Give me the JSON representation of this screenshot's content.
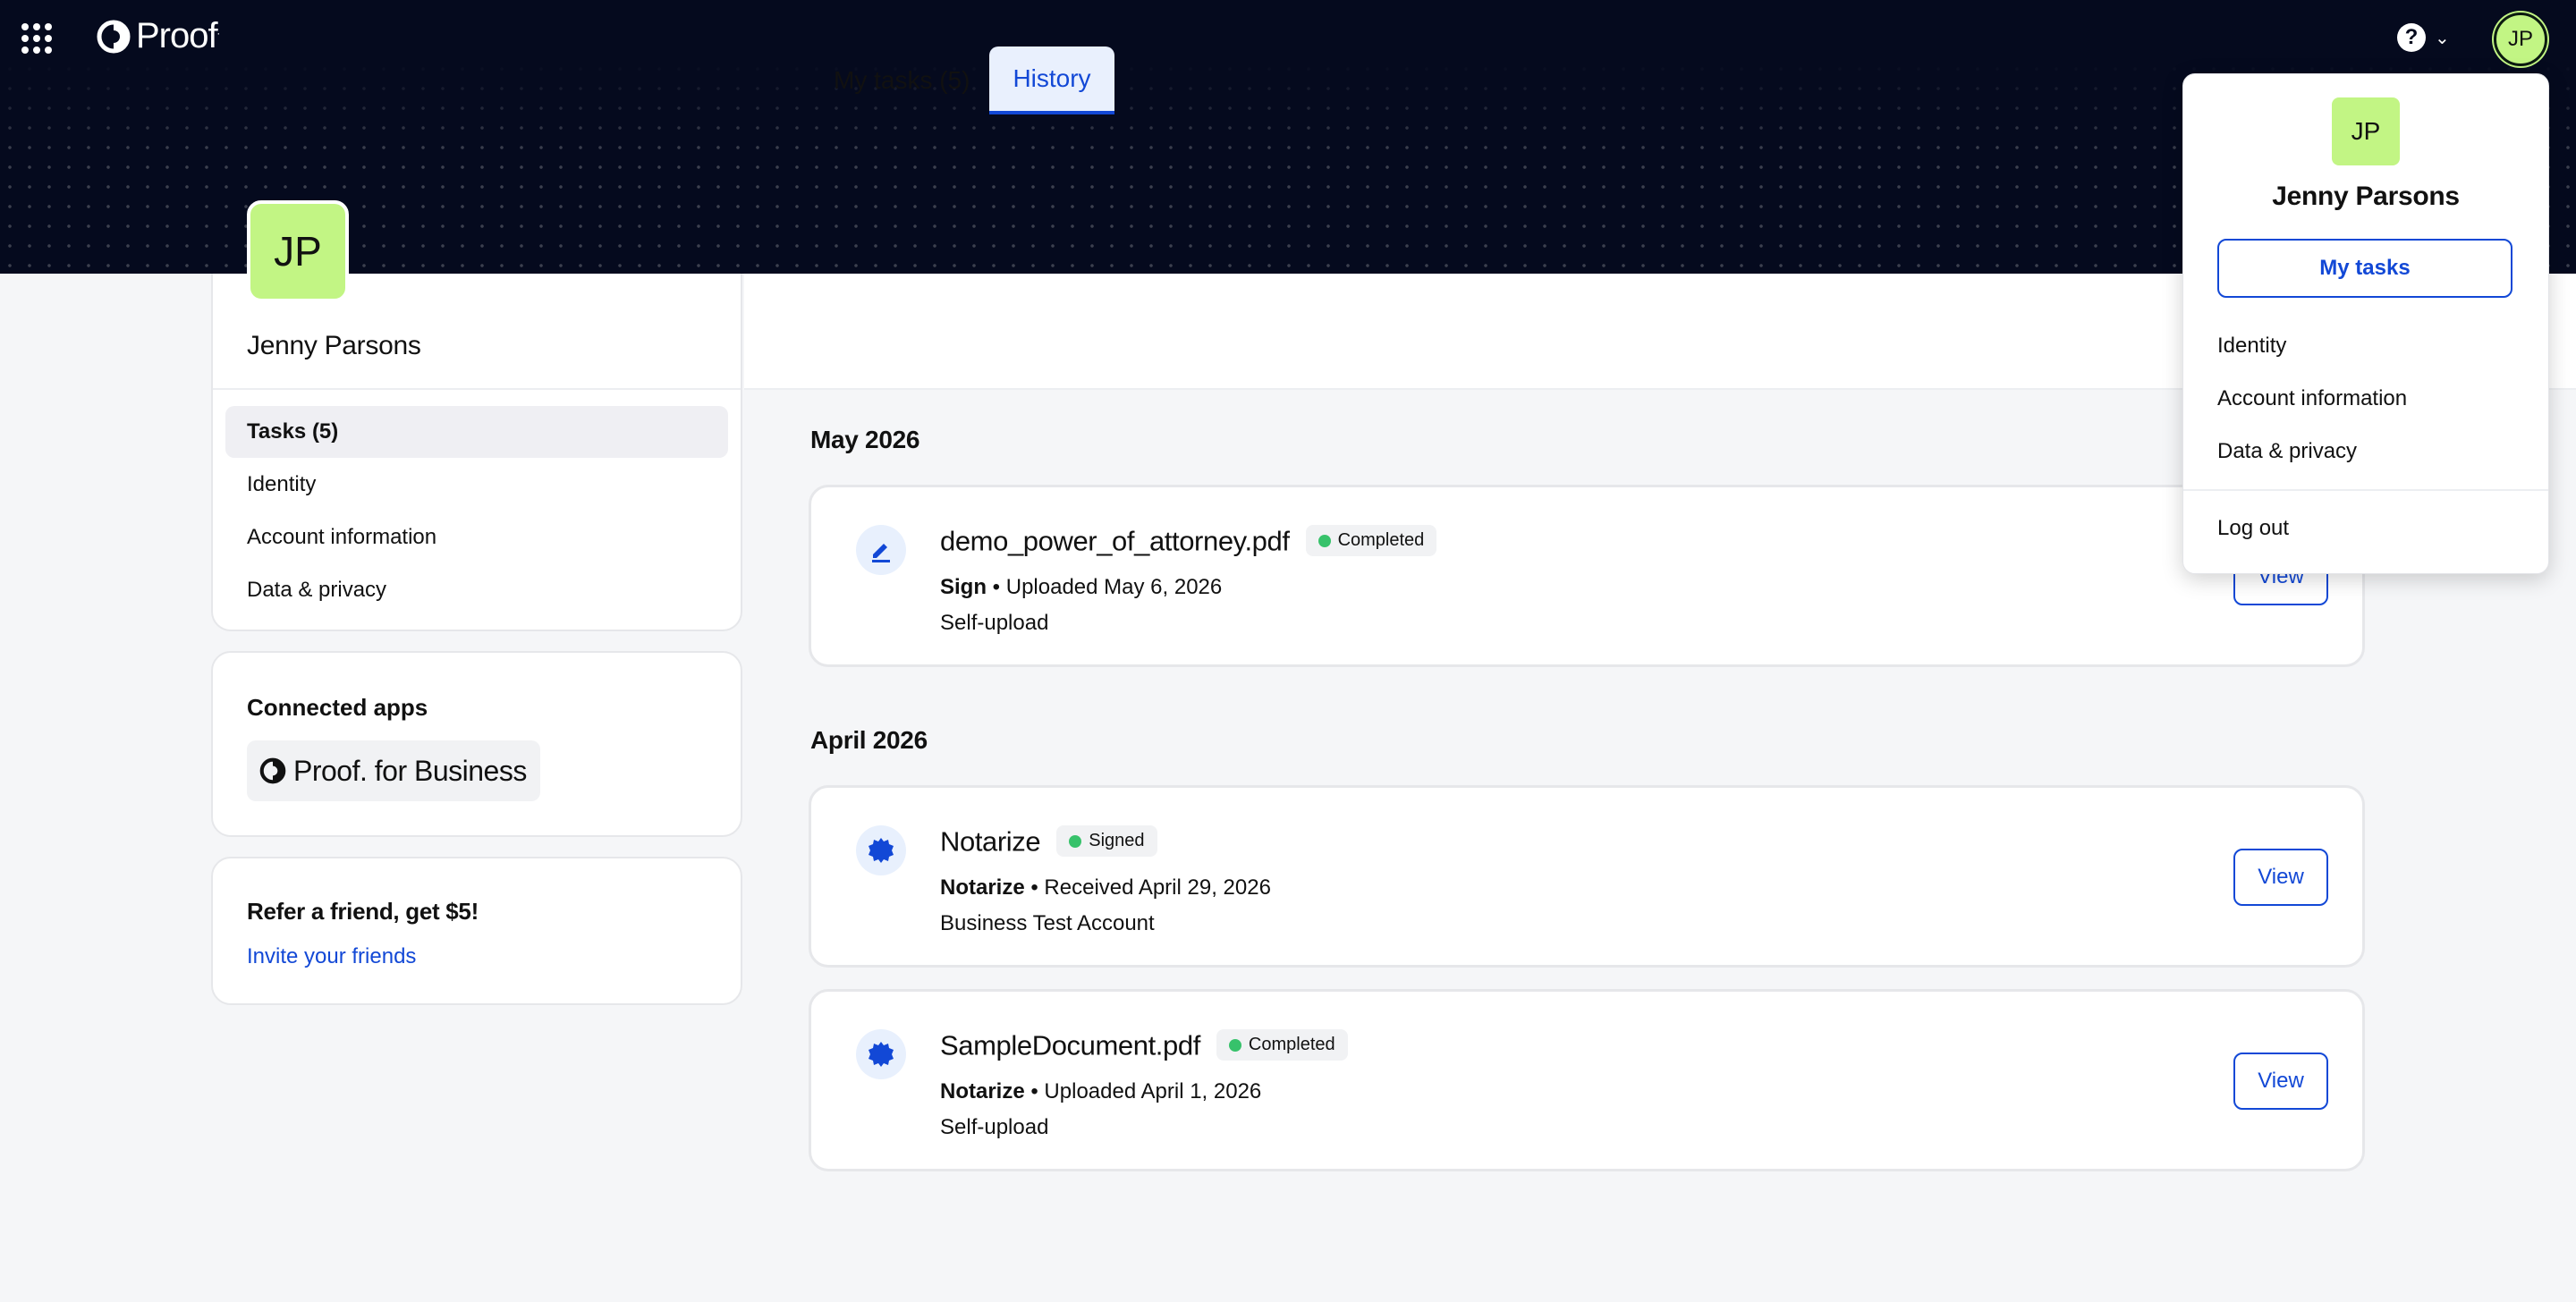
{
  "header": {
    "logo_text": "Proof",
    "logo_tm": ".",
    "help_icon_text": "?",
    "help_chevron": "⌄",
    "avatar_initials": "JP"
  },
  "profile": {
    "initials": "JP",
    "name": "Jenny Parsons"
  },
  "sidebar": {
    "items": [
      {
        "label": "Tasks (5)"
      },
      {
        "label": "Identity"
      },
      {
        "label": "Account information"
      },
      {
        "label": "Data & privacy"
      }
    ]
  },
  "connected_apps": {
    "title": "Connected apps",
    "app_label": "Proof. for Business"
  },
  "refer": {
    "title": "Refer a friend, get $5!",
    "link": "Invite your friends"
  },
  "tabs": [
    {
      "label": "My tasks (5)"
    },
    {
      "label": "History"
    }
  ],
  "history": {
    "groups": [
      {
        "month": "May 2026",
        "tasks": [
          {
            "title": "demo_power_of_attorney.pdf",
            "status": "Completed",
            "type": "Sign",
            "meta": " • Uploaded May 6, 2026",
            "source": "Self-upload",
            "action": "View"
          }
        ]
      },
      {
        "month": "April 2026",
        "tasks": [
          {
            "title": "Notarize",
            "status": "Signed",
            "type": "Notarize",
            "meta": " • Received April 29, 2026",
            "source": "Business Test Account",
            "action": "View"
          },
          {
            "title": "SampleDocument.pdf",
            "status": "Completed",
            "type": "Notarize",
            "meta": " • Uploaded April 1, 2026",
            "source": "Self-upload",
            "action": "View"
          }
        ]
      }
    ]
  },
  "dropdown": {
    "initials": "JP",
    "name": "Jenny Parsons",
    "primary": "My tasks",
    "items": [
      {
        "label": "Identity"
      },
      {
        "label": "Account information"
      },
      {
        "label": "Data & privacy"
      }
    ],
    "logout": "Log out"
  },
  "colors": {
    "brand_navy": "#050a1e",
    "accent_blue": "#1248d6",
    "avatar_green": "#c2f584",
    "status_green": "#37c26b"
  }
}
